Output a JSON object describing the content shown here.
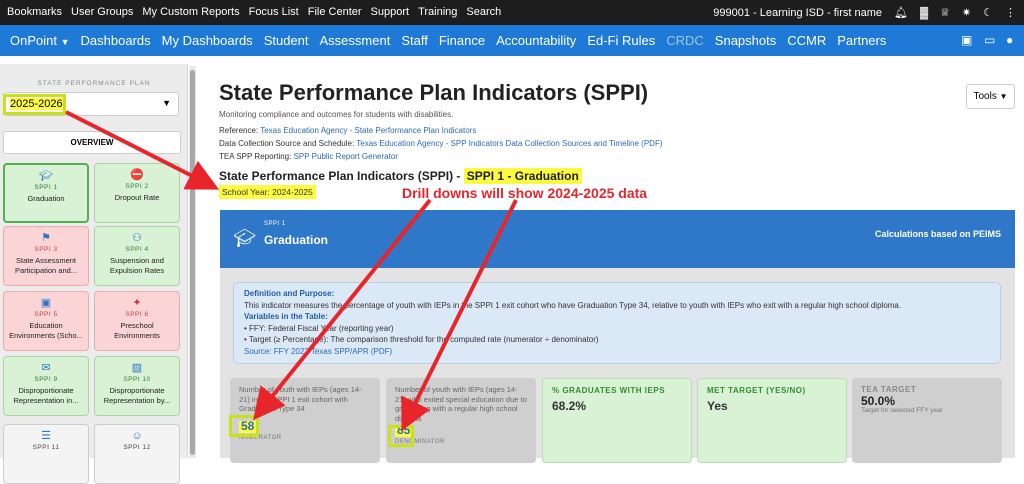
{
  "topbar": {
    "links": [
      "Bookmarks",
      "User Groups",
      "My Custom Reports",
      "Focus List",
      "File Center",
      "Support",
      "Training",
      "Search"
    ],
    "account": "999001 - Learning ISD - first name"
  },
  "nav": {
    "brand": "OnPoint",
    "items": [
      "Dashboards",
      "My Dashboards",
      "Student",
      "Assessment",
      "Staff",
      "Finance",
      "Accountability",
      "Ed-Fi Rules",
      "CRDC",
      "Snapshots",
      "CCMR",
      "Partners"
    ],
    "dimmed_item": "CRDC"
  },
  "sidebar": {
    "plan_label": "STATE PERFORMANCE PLAN",
    "year_value": "2025-2026",
    "overview": "OVERVIEW",
    "tiles": [
      {
        "code": "SPPI 1",
        "name": "Graduation",
        "status": "green",
        "icon": "graduate-icon"
      },
      {
        "code": "SPPI 2",
        "name": "Dropout Rate",
        "status": "green",
        "icon": "no-entry-icon"
      },
      {
        "code": "SPPI 3",
        "name": "State Assessment Participation and...",
        "status": "red",
        "icon": "texas-flag-icon"
      },
      {
        "code": "SPPI 4",
        "name": "Suspension and Expulsion Rates",
        "status": "green",
        "icon": "group-icon"
      },
      {
        "code": "SPPI 5",
        "name": "Education Environments (Scho...",
        "status": "red",
        "icon": "classroom-icon"
      },
      {
        "code": "SPPI 6",
        "name": "Preschool Environments",
        "status": "red",
        "icon": "running-child-icon"
      },
      {
        "code": "SPPI 9",
        "name": "Disproportionate Representation in...",
        "status": "green",
        "icon": "chat-icon"
      },
      {
        "code": "SPPI 10",
        "name": "Disproportionate Representation by...",
        "status": "green",
        "icon": "image-icon"
      },
      {
        "code": "SPPI 11",
        "name": "",
        "status": "white",
        "icon": "document-icon"
      },
      {
        "code": "SPPI 12",
        "name": "",
        "status": "white",
        "icon": "child-icon"
      }
    ]
  },
  "page": {
    "title": "State Performance Plan Indicators (SPPI)",
    "subtitle": "Monitoring compliance and outcomes for students with disabilities.",
    "reference_label": "Reference:",
    "reference_link": "Texas Education Agency - State Performance Plan Indicators",
    "schedule_label": "Data Collection Source and Schedule:",
    "schedule_link": "Texas Education Agency - SPP Indicators Data Collection Sources and Timeline (PDF)",
    "reporting_label": "TEA SPP Reporting:",
    "reporting_link": "SPP Public Report Generator",
    "tools": "Tools",
    "section_prefix": "State Performance Plan Indicators (SPPI) -",
    "section_highlight": "SPPI 1 - Graduation",
    "school_year": "School Year: 2024-2025",
    "annotation": "Drill downs will show 2024-2025 data"
  },
  "banner": {
    "code": "SPPI 1",
    "title": "Graduation",
    "calc": "Calculations based on PEIMS"
  },
  "definition": {
    "heading": "Definition and Purpose:",
    "text": "This indicator measures the percentage of youth with IEPs in the SPPI 1 exit cohort who have Graduation Type 34, relative to youth with IEPs who exit with a regular high school diploma.",
    "vars_heading": "Variables in the Table:",
    "ffy": "• FFY: Federal Fiscal Year (reporting year)",
    "target": "• Target (≥ Percentage): The comparison threshold for the computed rate (numerator ÷ denominator)",
    "source": "Source: FFY 2022 Texas SPP/APR (PDF)"
  },
  "metrics": {
    "numerator_desc": "Number of youth with IEPs (ages 14-21) in the SPPI 1 exit cohort with Graduation Type 34",
    "numerator_value": "58",
    "numerator_label": "NUMERATOR",
    "denominator_desc": "Number of youth with IEPs (ages 14-21) who exited special education due to graduating with a regular high school diploma",
    "denominator_value": "85",
    "denominator_label": "DENOMINATOR",
    "pct_label": "% GRADUATES WITH IEPS",
    "pct_value": "68.2%",
    "met_label": "MET TARGET (YES/NO)",
    "met_value": "Yes",
    "target_label": "TEA TARGET",
    "target_value": "50.0%",
    "target_sub": "Target for selected FFY year"
  },
  "colors": {
    "nav": "#1e7ad6",
    "topbar": "#1d1d1d",
    "banner": "#2f78c9",
    "highlight": "#fdfb3f",
    "arrow": "#e8252a"
  }
}
